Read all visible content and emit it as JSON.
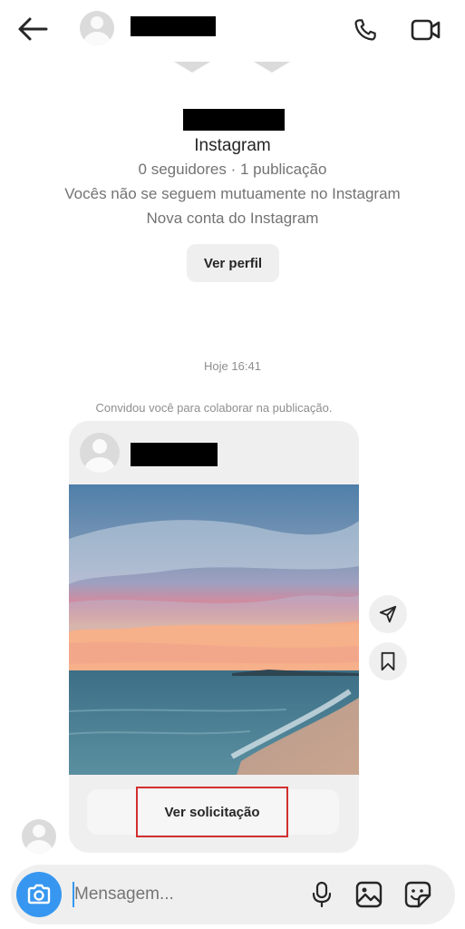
{
  "header": {
    "back_icon": "arrow-left-icon",
    "call_icon": "phone-icon",
    "video_icon": "video-camera-icon"
  },
  "profile": {
    "platform": "Instagram",
    "stats": "0 seguidores · 1 publicação",
    "mutual": "Vocês não se seguem mutuamente no Instagram",
    "account_note": "Nova conta do Instagram",
    "view_profile_label": "Ver perfil"
  },
  "thread": {
    "timestamp": "Hoje 16:41",
    "invite_text": "Convidou você para colaborar na publicação."
  },
  "post_card": {
    "request_label": "Ver solicitação",
    "share_icon": "paper-plane-icon",
    "save_icon": "bookmark-icon"
  },
  "composer": {
    "placeholder": "Mensagem...",
    "accent": "#3797f0",
    "icons": [
      "camera-icon",
      "microphone-icon",
      "gallery-icon",
      "sticker-icon"
    ]
  },
  "colors": {
    "highlight_border": "#d32f2f",
    "bubble_bg": "#efefef"
  }
}
